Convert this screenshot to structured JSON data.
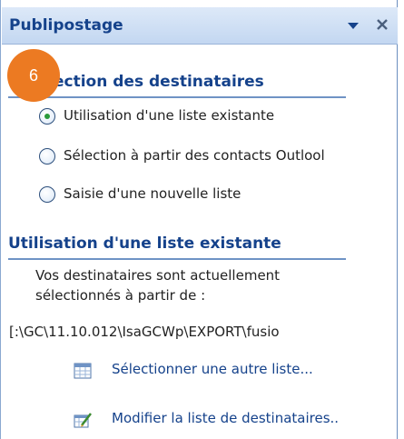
{
  "pane": {
    "title": "Publipostage",
    "menu_icon": "dropdown-triangle-icon",
    "close_icon": "close-icon"
  },
  "step_badge": "6",
  "selection_section": {
    "heading": "ection des destinataires",
    "options": [
      {
        "label": "Utilisation d'une liste existante",
        "selected": true
      },
      {
        "label": "Sélection à partir des contacts Outlool",
        "selected": false
      },
      {
        "label": "Saisie d'une nouvelle liste",
        "selected": false
      }
    ]
  },
  "existing_list_section": {
    "heading": "Utilisation d'une liste existante",
    "description_line1": "Vos destinataires sont actuellement",
    "description_line2": "sélectionnés à partir de :",
    "source_path": "[:\\GC\\11.10.012\\IsaGCWp\\EXPORT\\fusio",
    "links": [
      {
        "label": "Sélectionner une autre liste...",
        "icon": "table-list-icon"
      },
      {
        "label": "Modifier la liste de destinataires..",
        "icon": "edit-list-icon"
      }
    ]
  },
  "colors": {
    "heading": "#15428b",
    "badge": "#ec7a22",
    "rule": "#6f93c5",
    "radio_selected": "#2a9a3b"
  }
}
